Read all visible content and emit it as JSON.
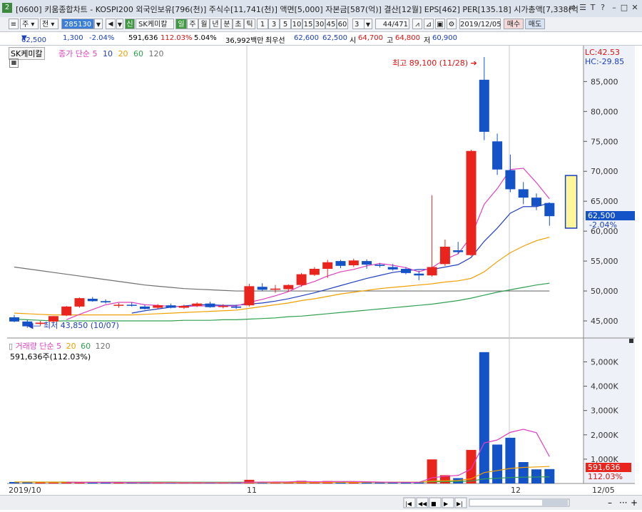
{
  "window": {
    "number": "2",
    "title": "[0600] 키움종합차트 - KOSPI200 외국인보유[796(천)] 주식수[11,741(천)] 액면[5,000] 자본금[587(억)] 결산[12월] EPS[462] PER[135.18] 시가총액[7,338(억",
    "buttons": [
      "⇄",
      "☰",
      "T",
      "?",
      "–",
      "□",
      "✕"
    ]
  },
  "toolbar": {
    "stock_type": "주",
    "market": "전",
    "code": "285130",
    "name_badge": "신",
    "name": "SK케미칼",
    "periods": [
      "일",
      "주",
      "월",
      "년",
      "분",
      "초",
      "틱"
    ],
    "intervals": [
      "1",
      "3",
      "5",
      "10",
      "15",
      "30",
      "45",
      "60"
    ],
    "count_value": "3",
    "counter": "44",
    "counter_total": "/471",
    "date": "2019/12/05",
    "buy_label": "매수",
    "sell_label": "매도"
  },
  "quote": {
    "price": "62,500",
    "change": "1,300",
    "change_pct": "-2.04%",
    "volume": "591,636",
    "vol_ratio": "112.03%",
    "turnover": "5.04%",
    "amount": "36,992백만",
    "best_label": "최우선",
    "ask": "62,600",
    "bid": "62,500",
    "open_label": "시",
    "open": "64,700",
    "high_label": "고",
    "high": "64,800",
    "low_label": "저",
    "low": "60,900"
  },
  "price_legend": {
    "name": "SK케미칼",
    "label": "종가 단순",
    "ma": [
      "5",
      "10",
      "20",
      "60",
      "120"
    ]
  },
  "volume_legend": {
    "label": "거래량 단순",
    "ma": [
      "5",
      "20",
      "60",
      "120"
    ],
    "current": "591,636주(112.03%)"
  },
  "right_panel": {
    "lc": "LC:42.53",
    "hc": "HC:-29.85",
    "price_tag": "62,500",
    "pct_tag": "-2.04%",
    "vol_tag": "591,636",
    "vol_pct_tag": "112.03%"
  },
  "annotations": {
    "high": "최고 89,100 (11/28)",
    "low": "최저 43,850 (10/07)"
  },
  "x_labels": [
    "2019/10",
    "11",
    "12",
    "12/05"
  ],
  "colors": {
    "up": "#e8241c",
    "down": "#1452c8",
    "ma5": "#e040c0",
    "ma10": "#2040c0",
    "ma20": "#f0a000",
    "ma60": "#30a050",
    "ma120": "#707070"
  },
  "chart_data": [
    {
      "type": "candlestick",
      "title": "SK케미칼",
      "y_ticks": [
        45000,
        50000,
        55000,
        60000,
        65000,
        70000,
        75000,
        80000,
        85000
      ],
      "ylim": [
        42500,
        91000
      ],
      "candles": [
        {
          "o": 45600,
          "h": 46000,
          "l": 44800,
          "c": 44900
        },
        {
          "o": 44900,
          "h": 45200,
          "l": 43850,
          "c": 44100
        },
        {
          "o": 44500,
          "h": 45000,
          "l": 44200,
          "c": 44700
        },
        {
          "o": 44900,
          "h": 45800,
          "l": 44700,
          "c": 45800
        },
        {
          "o": 45900,
          "h": 47500,
          "l": 45800,
          "c": 47400
        },
        {
          "o": 47400,
          "h": 48900,
          "l": 47200,
          "c": 48800
        },
        {
          "o": 48700,
          "h": 49000,
          "l": 48200,
          "c": 48300
        },
        {
          "o": 48300,
          "h": 48600,
          "l": 47900,
          "c": 48100
        },
        {
          "o": 47600,
          "h": 48000,
          "l": 47200,
          "c": 47700
        },
        {
          "o": 47700,
          "h": 48100,
          "l": 47400,
          "c": 47600
        },
        {
          "o": 47400,
          "h": 47700,
          "l": 46900,
          "c": 47000
        },
        {
          "o": 47200,
          "h": 47800,
          "l": 47000,
          "c": 47600
        },
        {
          "o": 47600,
          "h": 47900,
          "l": 47100,
          "c": 47200
        },
        {
          "o": 47200,
          "h": 47700,
          "l": 47000,
          "c": 47500
        },
        {
          "o": 47500,
          "h": 48100,
          "l": 47300,
          "c": 47900
        },
        {
          "o": 47900,
          "h": 48200,
          "l": 47200,
          "c": 47300
        },
        {
          "o": 47400,
          "h": 47800,
          "l": 47100,
          "c": 47500
        },
        {
          "o": 47400,
          "h": 47700,
          "l": 47000,
          "c": 47200
        },
        {
          "o": 47600,
          "h": 51200,
          "l": 47400,
          "c": 50800
        },
        {
          "o": 50700,
          "h": 51300,
          "l": 50000,
          "c": 50200
        },
        {
          "o": 50200,
          "h": 51000,
          "l": 49700,
          "c": 50400
        },
        {
          "o": 50300,
          "h": 51100,
          "l": 49900,
          "c": 51000
        },
        {
          "o": 51000,
          "h": 53000,
          "l": 50700,
          "c": 52800
        },
        {
          "o": 52700,
          "h": 54000,
          "l": 52500,
          "c": 53700
        },
        {
          "o": 53700,
          "h": 55200,
          "l": 52200,
          "c": 54800
        },
        {
          "o": 55000,
          "h": 55200,
          "l": 53800,
          "c": 54200
        },
        {
          "o": 54300,
          "h": 55400,
          "l": 54000,
          "c": 55100
        },
        {
          "o": 55000,
          "h": 55300,
          "l": 53700,
          "c": 54400
        },
        {
          "o": 54400,
          "h": 54700,
          "l": 53900,
          "c": 54200
        },
        {
          "o": 54000,
          "h": 54500,
          "l": 53400,
          "c": 53600
        },
        {
          "o": 53700,
          "h": 54000,
          "l": 52800,
          "c": 53000
        },
        {
          "o": 52900,
          "h": 53400,
          "l": 51800,
          "c": 52600
        },
        {
          "o": 52600,
          "h": 66000,
          "l": 52400,
          "c": 54000
        },
        {
          "o": 54500,
          "h": 58600,
          "l": 54200,
          "c": 57400
        },
        {
          "o": 56800,
          "h": 58200,
          "l": 56200,
          "c": 56500
        },
        {
          "o": 56000,
          "h": 73600,
          "l": 55800,
          "c": 73400
        },
        {
          "o": 85300,
          "h": 89100,
          "l": 75200,
          "c": 76600
        },
        {
          "o": 75000,
          "h": 76300,
          "l": 69400,
          "c": 70300
        },
        {
          "o": 70200,
          "h": 72800,
          "l": 66500,
          "c": 67000
        },
        {
          "o": 67000,
          "h": 68200,
          "l": 64500,
          "c": 65600
        },
        {
          "o": 65600,
          "h": 66300,
          "l": 63500,
          "c": 64200
        },
        {
          "o": 64700,
          "h": 64800,
          "l": 60900,
          "c": 62500
        }
      ],
      "ma5": [
        null,
        null,
        null,
        null,
        45200,
        46100,
        46900,
        47700,
        48100,
        48100,
        47700,
        47600,
        47400,
        47400,
        47500,
        47500,
        47500,
        47500,
        48100,
        48600,
        49200,
        49900,
        50900,
        51600,
        52500,
        53200,
        53600,
        54200,
        54600,
        54300,
        53900,
        53200,
        53900,
        55300,
        56200,
        59100,
        64500,
        67100,
        70300,
        70500,
        68100,
        65400
      ],
      "ma10": [
        null,
        null,
        null,
        null,
        null,
        null,
        null,
        null,
        null,
        46300,
        46700,
        47000,
        47300,
        47500,
        47700,
        47700,
        47600,
        47600,
        47800,
        48000,
        48300,
        48700,
        49200,
        49700,
        50300,
        50900,
        51500,
        52100,
        52600,
        53100,
        53400,
        53600,
        53600,
        54000,
        54400,
        55600,
        58300,
        60500,
        63000,
        64100,
        64100,
        64700
      ],
      "ma20": [
        46300,
        46200,
        46100,
        46000,
        46000,
        46000,
        46000,
        46000,
        46000,
        46000,
        46100,
        46200,
        46300,
        46400,
        46500,
        46600,
        46700,
        46800,
        47100,
        47400,
        47700,
        48000,
        48400,
        48700,
        49100,
        49500,
        49800,
        50100,
        50400,
        50600,
        50800,
        51000,
        51200,
        51500,
        51700,
        52100,
        53200,
        54900,
        56400,
        57500,
        58400,
        59000
      ],
      "ma60": [
        45300,
        45200,
        45100,
        45000,
        45000,
        45000,
        45000,
        45000,
        45000,
        45000,
        45000,
        45000,
        45000,
        45100,
        45100,
        45100,
        45200,
        45200,
        45300,
        45400,
        45500,
        45700,
        45800,
        46000,
        46200,
        46400,
        46600,
        46800,
        47000,
        47200,
        47400,
        47600,
        47800,
        48100,
        48400,
        48800,
        49300,
        49800,
        50200,
        50600,
        51000,
        51300
      ],
      "ma120": [
        54000,
        53700,
        53400,
        53100,
        52800,
        52500,
        52200,
        51900,
        51600,
        51300,
        51000,
        50800,
        50600,
        50400,
        50300,
        50200,
        50100,
        50000,
        50000,
        50000,
        50000,
        50000,
        50000,
        50000,
        50000,
        50000,
        50000,
        50000,
        50000,
        50000,
        50000,
        50000,
        50000,
        50000,
        50000,
        50000,
        50000,
        50000,
        50000,
        50000,
        50000,
        50000
      ],
      "projection_box": {
        "low": 60500,
        "high": 69300
      }
    },
    {
      "type": "bar",
      "title": "거래량",
      "y_ticks": [
        1000,
        2000,
        3000,
        4000,
        5000
      ],
      "y_tick_labels": [
        "1,000K",
        "2,000K",
        "3,000K",
        "4,000K",
        "5,000K"
      ],
      "ylim": [
        0,
        5600
      ],
      "values": [
        60,
        50,
        45,
        40,
        55,
        50,
        40,
        35,
        30,
        30,
        30,
        25,
        25,
        25,
        30,
        30,
        25,
        25,
        150,
        60,
        50,
        50,
        110,
        80,
        100,
        60,
        50,
        45,
        40,
        45,
        50,
        40,
        990,
        340,
        220,
        1380,
        5400,
        1600,
        1880,
        880,
        580,
        592
      ],
      "up": [
        false,
        false,
        true,
        true,
        true,
        true,
        false,
        false,
        true,
        false,
        false,
        true,
        false,
        true,
        true,
        false,
        true,
        false,
        true,
        false,
        true,
        true,
        true,
        true,
        true,
        false,
        true,
        false,
        false,
        false,
        false,
        false,
        true,
        true,
        false,
        true,
        false,
        false,
        false,
        false,
        false,
        false
      ],
      "ma5": [
        null,
        null,
        null,
        null,
        50,
        48,
        46,
        45,
        42,
        37,
        33,
        30,
        28,
        27,
        27,
        27,
        27,
        27,
        51,
        58,
        62,
        67,
        84,
        70,
        78,
        80,
        80,
        70,
        59,
        50,
        46,
        44,
        232,
        300,
        330,
        594,
        1666,
        1788,
        2104,
        2228,
        2088,
        1106
      ],
      "ma20": [
        60,
        58,
        56,
        54,
        53,
        52,
        50,
        48,
        46,
        44,
        42,
        41,
        40,
        39,
        38,
        37,
        36,
        35,
        40,
        41,
        40,
        39,
        42,
        44,
        46,
        47,
        48,
        49,
        50,
        51,
        52,
        52,
        100,
        115,
        125,
        190,
        450,
        530,
        620,
        660,
        680,
        700
      ],
      "ma60": [
        60,
        60,
        59,
        58,
        58,
        57,
        57,
        56,
        56,
        55,
        55,
        54,
        54,
        53,
        53,
        52,
        52,
        52,
        53,
        53,
        53,
        53,
        54,
        54,
        55,
        55,
        55,
        55,
        56,
        56,
        56,
        56,
        72,
        77,
        80,
        101,
        189,
        215,
        246,
        258,
        266,
        275
      ]
    }
  ]
}
